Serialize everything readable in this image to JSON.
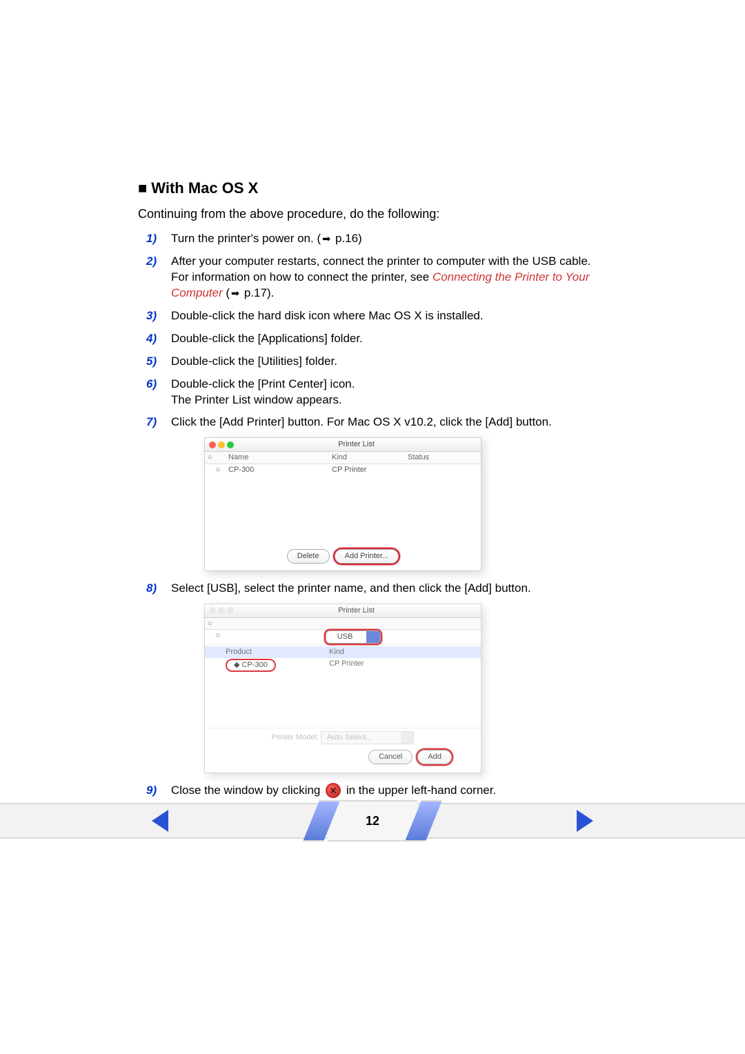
{
  "heading": "With Mac OS X",
  "intro": "Continuing from the above procedure, do the following:",
  "link_text": "Connecting the Printer to Your Computer",
  "steps": {
    "s1_a": "Turn the printer's power on. (",
    "s1_b": " p.16)",
    "s2_a": "After your computer restarts, connect the printer to computer with the USB cable.",
    "s2_b": "For information on how to connect the printer, see ",
    "s2_c": " (",
    "s2_d": " p.17).",
    "s3": "Double-click the hard disk icon where Mac OS X is installed.",
    "s4": "Double-click the [Applications] folder.",
    "s5": "Double-click the [Utilities] folder.",
    "s6_a": "Double-click the [Print Center] icon.",
    "s6_b": "The Printer List window appears.",
    "s7": "Click the [Add Printer] button. For Mac OS X v10.2, click the [Add] button.",
    "s8": "Select [USB], select the printer name, and then click the [Add] button.",
    "s9_a": "Close the window by clicking ",
    "s9_b": " in the upper left-hand corner."
  },
  "shot1": {
    "title": "Printer List",
    "col_name": "Name",
    "col_kind": "Kind",
    "col_status": "Status",
    "row_name": "CP-300",
    "row_kind": "CP Printer",
    "btn_delete": "Delete",
    "btn_add": "Add Printer..."
  },
  "shot2": {
    "title": "Printer List",
    "dropdown": "USB",
    "col_product": "Product",
    "col_kind": "Kind",
    "row_name": "CP-300",
    "row_kind": "CP Printer",
    "model_label": "Printer Model:",
    "model_value": "Auto Select...",
    "btn_cancel": "Cancel",
    "btn_add": "Add"
  },
  "page_number": "12"
}
